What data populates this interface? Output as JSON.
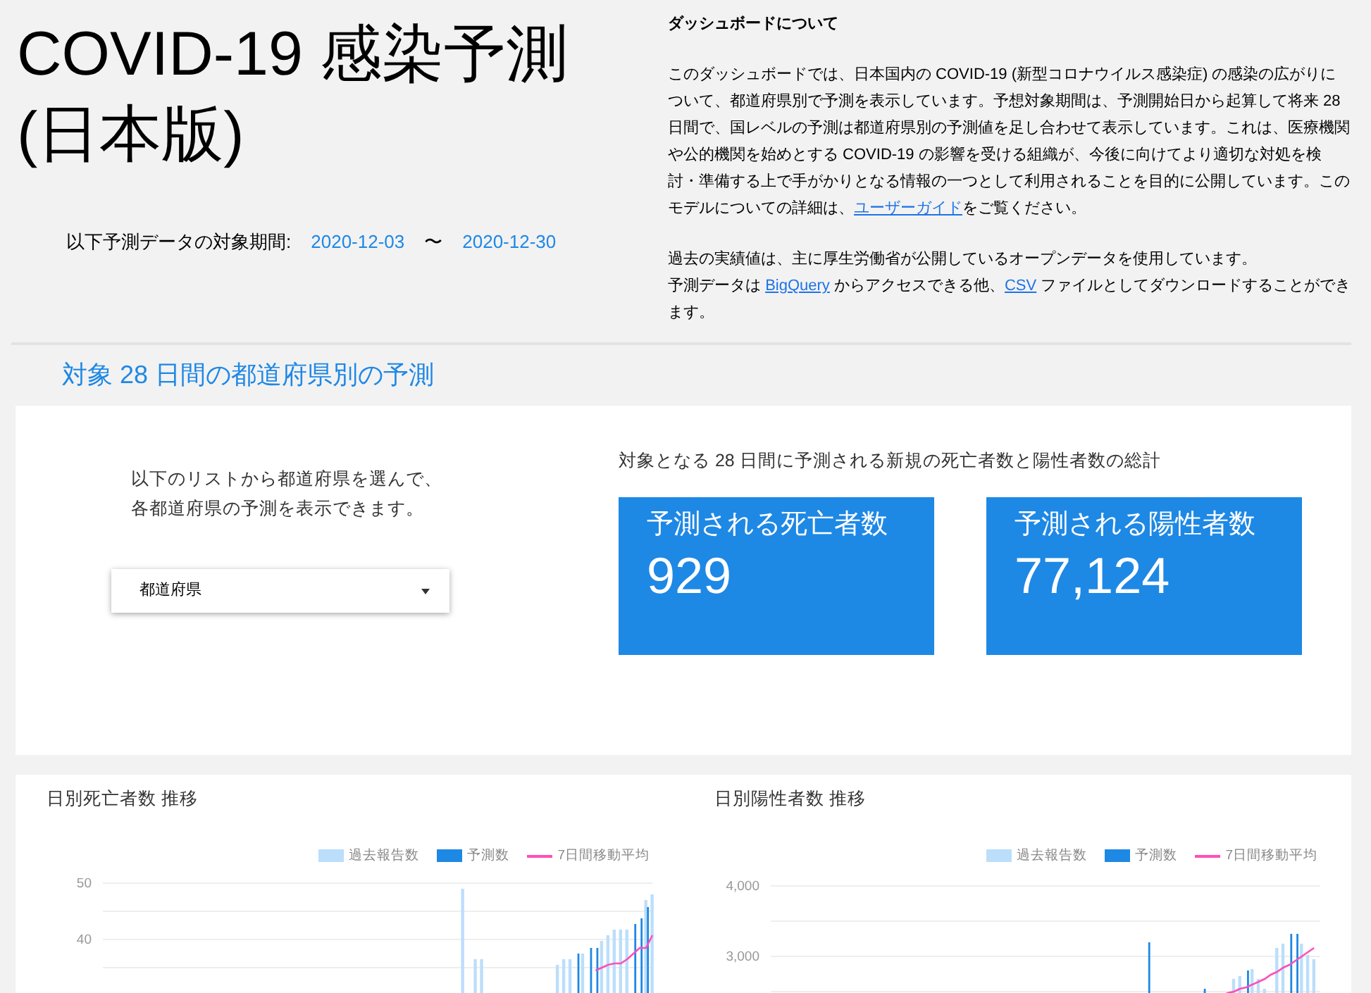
{
  "header": {
    "title_line_1": "COVID-19 感染予測",
    "title_line_2": "(日本版)",
    "period_label": "以下予測データの対象期間:",
    "period_start": "2020-12-03",
    "period_separator": "〜",
    "period_end": "2020-12-30"
  },
  "about": {
    "heading": "ダッシュボードについて",
    "paragraph_1": [
      "このダッシュボードでは、日本国内の COVID-19 (新型コロナウイルス感染症) の感染の広がりについて、都道府県別で予測を表示しています。予想対象期間は、予測開始日から起算して将来 28 日間で、国レベルの予測は都道府県別の予測値を足し合わせて表示しています。これは、医療機関や公的機関を始めとする COVID-19 の影響を受ける組織が、今後に向けてより適切な対処を検討・準備する上で手がかりとなる情報の一つとして利用されることを目的に公開しています。このモデルについての詳細は、",
      "ユーザーガイド",
      "をご覧ください。"
    ],
    "paragraph_2": "過去の実績値は、主に厚生労働省が公開しているオープンデータを使用しています。",
    "paragraph_3": [
      "予測データは ",
      "BigQuery",
      " からアクセスできる他、",
      "CSV",
      " ファイルとしてダウンロードすることができます。"
    ]
  },
  "section_title": "対象 28 日間の都道府県別の予測",
  "prefecture_panel": {
    "instruction_line_1": "以下のリストから都道府県を選んで、",
    "instruction_line_2": "各都道府県の予測を表示できます。",
    "select": {
      "value": "都道府県"
    }
  },
  "totals": {
    "heading": "対象となる 28 日間に予測される新規の死亡者数と陽性者数の総計",
    "tiles": [
      {
        "label": "予測される死亡者数",
        "value": "929"
      },
      {
        "label": "予測される陽性者数",
        "value": "77,124"
      }
    ]
  },
  "charts": [
    {
      "title": "日別死亡者数 推移",
      "legend": [
        {
          "label": "過去報告数",
          "color": "#bbdefb"
        },
        {
          "label": "予測数",
          "color": "#1e88e5"
        },
        {
          "label": "7日間移動平均",
          "color": "#ff4fb8"
        }
      ],
      "axis_labels": [
        "50",
        "40"
      ]
    },
    {
      "title": "日別陽性者数 推移",
      "legend": [
        {
          "label": "過去報告数",
          "color": "#bbdefb"
        },
        {
          "label": "予測数",
          "color": "#1e88e5"
        },
        {
          "label": "7日間移動平均",
          "color": "#ff4fb8"
        }
      ],
      "axis_labels": [
        "4,000",
        "3,000"
      ]
    }
  ]
}
